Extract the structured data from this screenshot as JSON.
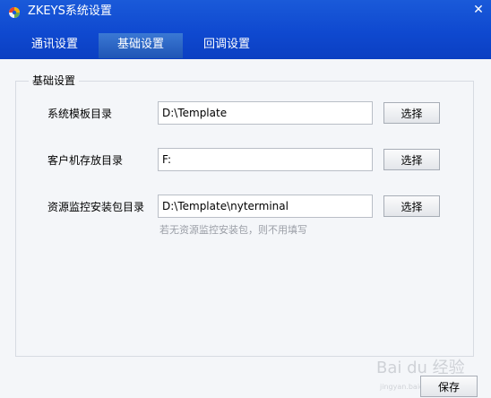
{
  "window": {
    "title": "ZKEYS系统设置",
    "close_glyph": "✕"
  },
  "tabs": [
    {
      "label": "通讯设置",
      "active": false
    },
    {
      "label": "基础设置",
      "active": true
    },
    {
      "label": "回调设置",
      "active": false
    }
  ],
  "group": {
    "title": "基础设置",
    "rows": [
      {
        "label": "系统模板目录",
        "value": "D:\\Template",
        "button": "选择"
      },
      {
        "label": "客户机存放目录",
        "value": "F:",
        "button": "选择"
      },
      {
        "label": "资源监控安装包目录",
        "value": "D:\\Template\\nyterminal",
        "button": "选择"
      }
    ],
    "hint": "若无资源监控安装包，则不用填写"
  },
  "footer": {
    "save_label": "保存"
  },
  "watermark": {
    "text": "Bai du 经验",
    "url": "jingyan.baidu.com"
  },
  "colors": {
    "header": "#0f49d0",
    "active_tab": "#2a66c6",
    "content_bg": "#f4f6f9"
  }
}
